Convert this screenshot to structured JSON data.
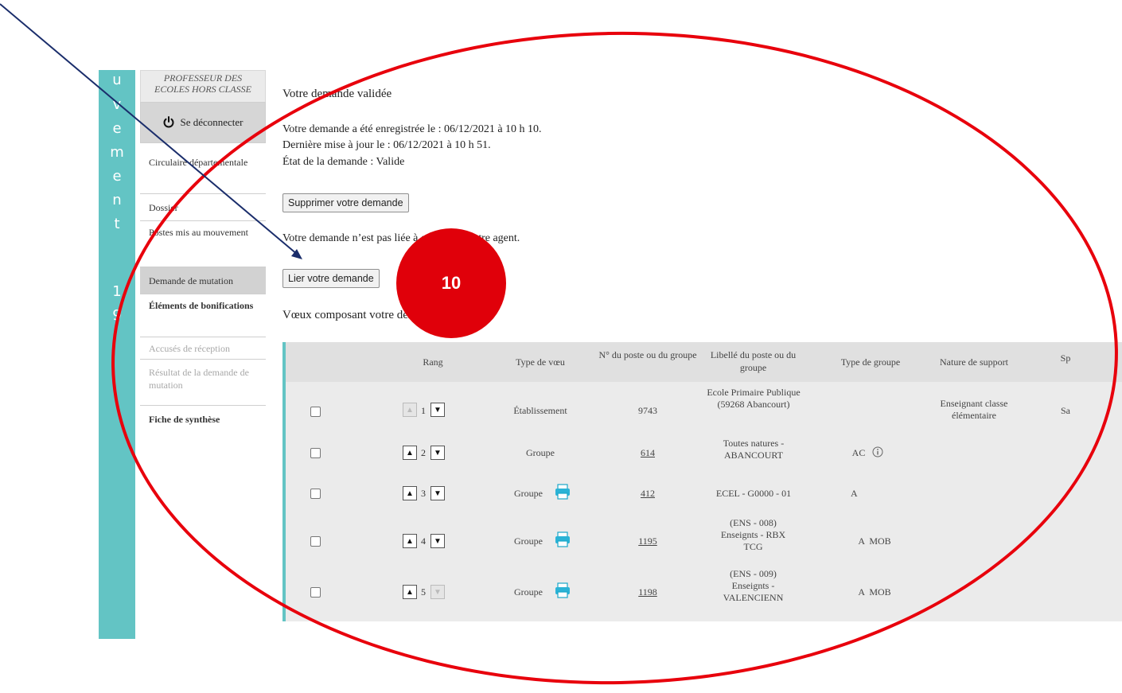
{
  "sidebar": {
    "vertical_letters": [
      "u",
      "v",
      "e",
      "m",
      "e",
      "n",
      "t",
      "1",
      "9"
    ],
    "profile_line1": "PROFESSEUR DES",
    "profile_line2": "ECOLES HORS CLASSE",
    "logout_label": "Se déconnecter",
    "items": [
      {
        "label": "Circulaire départementale",
        "state": "normal"
      },
      {
        "label": "Dossier",
        "state": "normal"
      },
      {
        "label": "Postes mis au mouvement",
        "state": "normal"
      },
      {
        "label": "Demande de mutation",
        "state": "active"
      },
      {
        "label": "Éléments de bonifications",
        "state": "normal"
      },
      {
        "label": "Accusés de réception",
        "state": "disabled"
      },
      {
        "label": "Résultat de la demande de mutation",
        "state": "disabled"
      },
      {
        "label": "Fiche de synthèse",
        "state": "normal"
      }
    ]
  },
  "main": {
    "title": "Votre demande validée",
    "registered": "Votre demande a été enregistrée le : 06/12/2021 à 10 h 10.",
    "updated": "Dernière mise à jour le : 06/12/2021 à 10 h 51.",
    "state": "État de la demande : Valide",
    "delete_button": "Supprimer votre demande",
    "link_info": "Votre demande n’est pas liée à celle d’un autre agent.",
    "link_button": "Lier votre demande",
    "wishes_title": "Vœux composant votre demande validée"
  },
  "table": {
    "headers": {
      "rank": "Rang",
      "type": "Type de vœu",
      "number": "N° du poste ou du groupe",
      "label": "Libellé du poste ou du groupe",
      "group_type": "Type de groupe",
      "support": "Nature de support",
      "extra": "Sp"
    },
    "rows": [
      {
        "rank": "1",
        "type": "Établissement",
        "number": "9743",
        "label": "Ecole Primaire Publique (59268 Abancourt)",
        "group_type": "",
        "support": "Enseignant classe élémentaire",
        "extra": "Sa"
      },
      {
        "rank": "2",
        "type": "Groupe",
        "number": "614",
        "label": "Toutes natures - ABANCOURT",
        "group_type": "AC",
        "support": "",
        "extra": ""
      },
      {
        "rank": "3",
        "type": "Groupe",
        "number": "412",
        "label": "ECEL - G0000 - 01",
        "group_type": "A",
        "support": "",
        "extra": ""
      },
      {
        "rank": "4",
        "type": "Groupe",
        "number": "1195",
        "label": "(ENS - 008) Enseignts - RBX TCG",
        "group_type": "A  MOB",
        "support": "",
        "extra": ""
      },
      {
        "rank": "5",
        "type": "Groupe",
        "number": "1198",
        "label": "(ENS - 009) Enseignts - VALENCIENN",
        "group_type": "A  MOB",
        "support": "",
        "extra": ""
      }
    ]
  },
  "annotation": {
    "step_number": "10",
    "color": "#e0000a"
  }
}
